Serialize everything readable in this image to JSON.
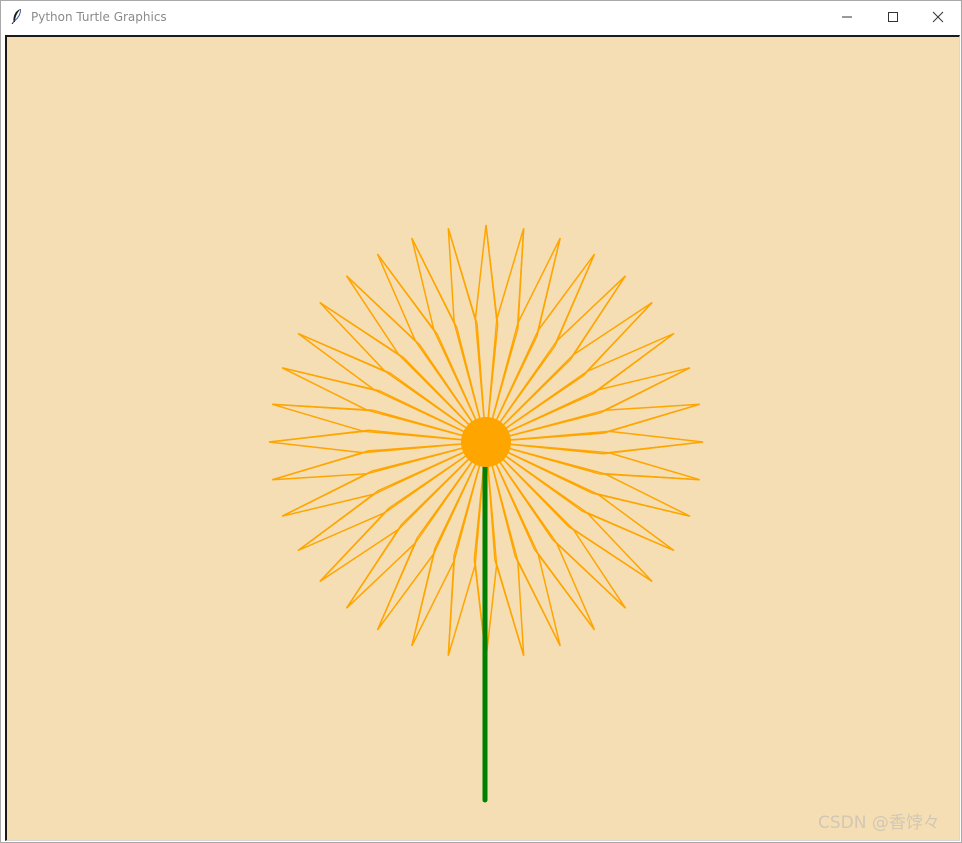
{
  "window": {
    "title": "Python Turtle Graphics",
    "app_icon": "feather-icon",
    "controls": {
      "minimize_icon": "minimize-icon",
      "maximize_icon": "maximize-icon",
      "close_icon": "close-icon"
    }
  },
  "canvas": {
    "background_color": "#f5deb3",
    "drawing": {
      "flower": {
        "petal_color": "#ffa500",
        "center_color": "#ffa500",
        "stem_color": "#008000",
        "petal_points": 36,
        "petal_count": 36
      }
    }
  },
  "watermark": {
    "text": "CSDN @香饽々"
  }
}
